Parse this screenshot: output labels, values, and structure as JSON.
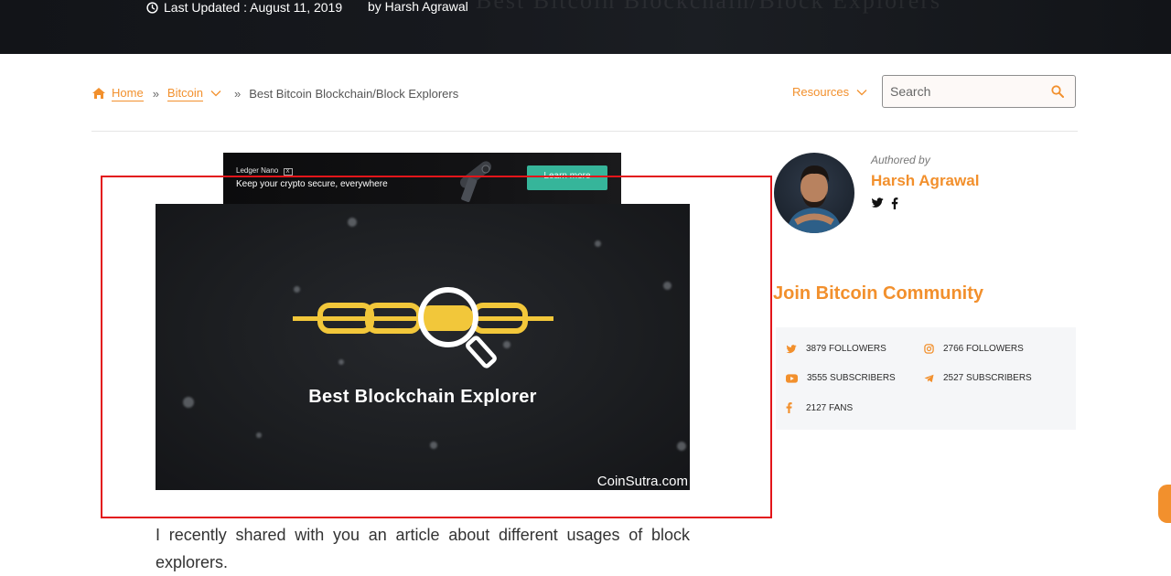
{
  "hero": {
    "last_updated": "Last Updated : August 11, 2019",
    "author": "by Harsh Agrawal",
    "ghost_title": "Best Bitcoin Blockchain/Block Explorers"
  },
  "breadcrumb": {
    "home": "Home",
    "separator": "»",
    "category": "Bitcoin",
    "current": "Best Bitcoin Blockchain/Block Explorers"
  },
  "nav": {
    "resources": "Resources"
  },
  "search": {
    "placeholder": "Search"
  },
  "ad": {
    "brand": "Ledger Nano",
    "brand_badge": "X",
    "tagline": "Keep your crypto secure, everywhere",
    "cta": "Learn more"
  },
  "featured_image": {
    "title": "Best Blockchain Explorer",
    "credit": "CoinSutra.com"
  },
  "article": {
    "first_paragraph": "I recently shared with you an article about different usages of block explorers."
  },
  "author_card": {
    "label": "Authored by",
    "name": "Harsh Agrawal",
    "social": [
      "twitter-icon",
      "facebook-icon"
    ]
  },
  "community": {
    "heading": "Join Bitcoin Community",
    "stats": [
      {
        "icon": "twitter-icon",
        "text": "3879 FOLLOWERS"
      },
      {
        "icon": "instagram-icon",
        "text": "2766 FOLLOWERS"
      },
      {
        "icon": "youtube-icon",
        "text": "3555 SUBSCRIBERS"
      },
      {
        "icon": "telegram-icon",
        "text": "2527 SUBSCRIBERS"
      },
      {
        "icon": "facebook-icon",
        "text": "2127 FANS"
      }
    ]
  },
  "colors": {
    "accent": "#f2902d",
    "highlight_box": "#e3151a",
    "hero_bg": "#15171b"
  }
}
